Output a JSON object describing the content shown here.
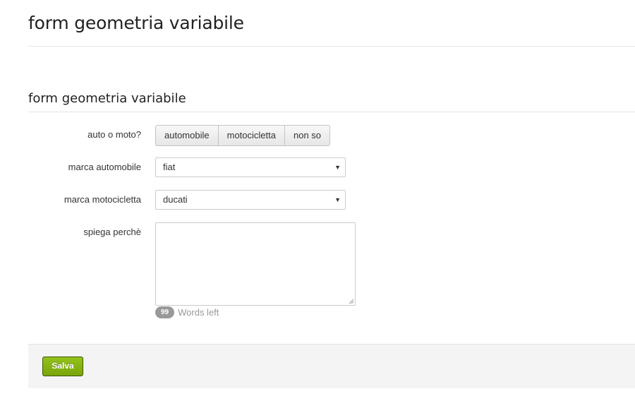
{
  "page": {
    "title": "form geometria variabile"
  },
  "form": {
    "title": "form geometria variabile",
    "fields": {
      "vehicle_type": {
        "label": "auto o moto?",
        "options": [
          "automobile",
          "motocicletta",
          "non so"
        ]
      },
      "car_brand": {
        "label": "marca automobile",
        "value": "fiat"
      },
      "moto_brand": {
        "label": "marca motocicletta",
        "value": "ducati"
      },
      "explain": {
        "label": "spiega perchè",
        "value": "",
        "words_left_count": "99",
        "words_left_label": "Words left"
      }
    },
    "save_label": "Salva"
  },
  "icons": {
    "select_caret": "caret-down-icon",
    "resize": "resize-grip-icon"
  },
  "colors": {
    "save_button": "#86b414",
    "save_button_border": "#3c5a00",
    "footer_bg": "#f4f4f4",
    "badge_bg": "#999999"
  }
}
